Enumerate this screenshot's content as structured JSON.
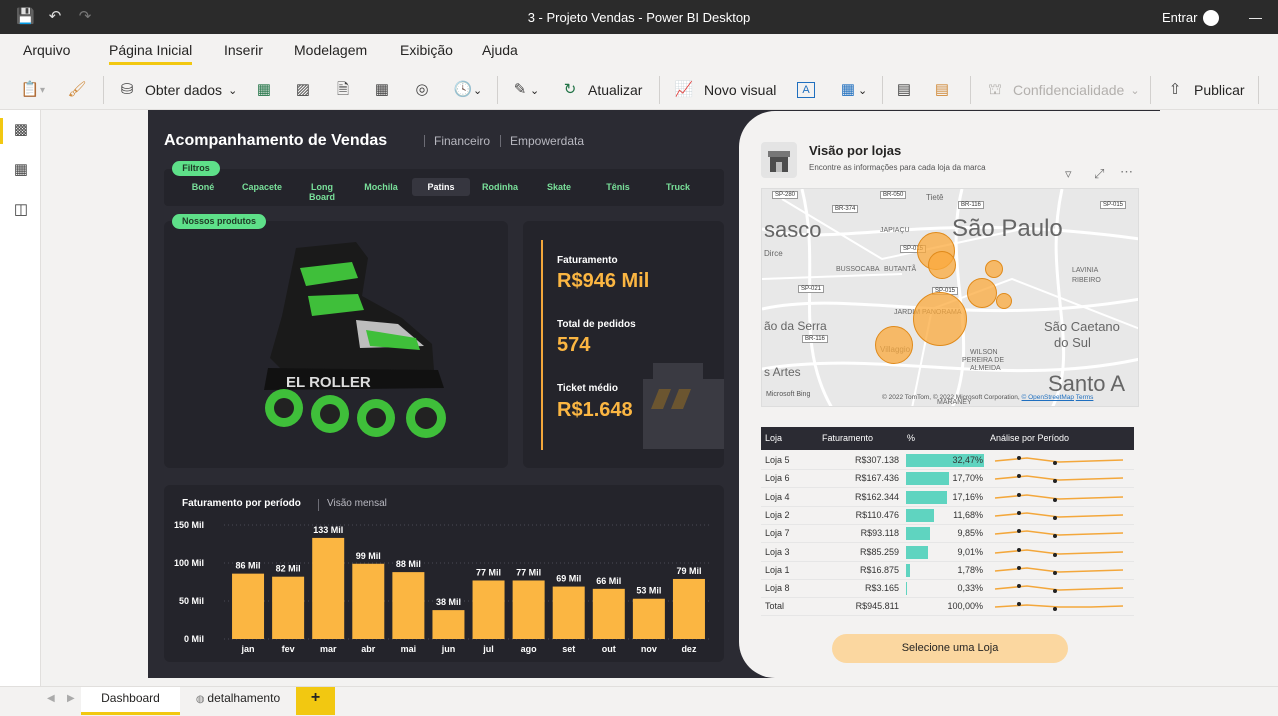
{
  "titlebar": {
    "title": "3 - Projeto Vendas - Power BI Desktop",
    "signin": "Entrar",
    "minimize": "—"
  },
  "menu": [
    "Arquivo",
    "Página Inicial",
    "Inserir",
    "Modelagem",
    "Exibição",
    "Ajuda"
  ],
  "ribbon": {
    "get_data": "Obter dados",
    "refresh": "Atualizar",
    "new_visual": "Novo visual",
    "sensitivity": "Confidencialidade",
    "publish": "Publicar"
  },
  "report": {
    "title": "Acompanhamento de Vendas",
    "subtitle1": "Financeiro",
    "subtitle2": "Empowerdata",
    "filters_label": "Filtros",
    "filters": [
      "Boné",
      "Capacete",
      "Long Board",
      "Mochila",
      "Patins",
      "Rodinha",
      "Skate",
      "Tênis",
      "Truck"
    ],
    "selected_filter": "Patins",
    "products_label": "Nossos produtos",
    "kpis": [
      {
        "label": "Faturamento",
        "value": "R$946 Mil"
      },
      {
        "label": "Total de pedidos",
        "value": "574"
      },
      {
        "label": "Ticket médio",
        "value": "R$1.648"
      }
    ]
  },
  "chart_title": "Faturamento por período",
  "chart_subtitle": "Visão mensal",
  "chart_data": {
    "type": "bar",
    "categories": [
      "jan",
      "fev",
      "mar",
      "abr",
      "mai",
      "jun",
      "jul",
      "ago",
      "set",
      "out",
      "nov",
      "dez"
    ],
    "values": [
      86,
      82,
      133,
      99,
      88,
      38,
      77,
      77,
      69,
      66,
      53,
      79
    ],
    "data_labels": [
      "86 Mil",
      "82 Mil",
      "133 Mil",
      "99 Mil",
      "88 Mil",
      "38 Mil",
      "77 Mil",
      "77 Mil",
      "69 Mil",
      "66 Mil",
      "53 Mil",
      "79 Mil"
    ],
    "y_ticks": [
      "150 Mil",
      "100 Mil",
      "50 Mil",
      "0 Mil"
    ],
    "ylim": [
      0,
      150
    ],
    "bar_color": "#fbb642"
  },
  "right": {
    "title": "Visão por lojas",
    "subtitle": "Encontre as informações para cada loja da marca",
    "map": {
      "labels": [
        "sasco",
        "São Paulo",
        "Dirce",
        "JAPIAÇU",
        "BUSSOCABA",
        "BUTANTÃ",
        "JARDIM PANORAMA",
        "ão da Serra",
        "WILSON",
        "PEREIRA DE",
        "ALMEIDA",
        "Villaggio",
        "s Artes",
        "São Caetano",
        "do Sul",
        "Santo A",
        "LAVINIA",
        "RIBEIRO",
        "Tietê",
        "MARANEY"
      ],
      "roads": [
        "SP-280",
        "BR-050",
        "BR-374",
        "BR-116",
        "SP-015",
        "SP-021",
        "SP-015",
        "SP-015",
        "BR-116"
      ],
      "bing": "Microsoft Bing",
      "copyright": "© 2022 TomTom, © 2022 Microsoft Corporation, ",
      "osm": "© OpenStreetMap",
      "terms": "Terms"
    },
    "table": {
      "headers": [
        "Loja",
        "Faturamento",
        "%",
        "Análise por Período"
      ],
      "rows": [
        {
          "loja": "Loja 5",
          "fat": "R$307.138",
          "pct": "32,47%",
          "p": 32.47
        },
        {
          "loja": "Loja 6",
          "fat": "R$167.436",
          "pct": "17,70%",
          "p": 17.7
        },
        {
          "loja": "Loja 4",
          "fat": "R$162.344",
          "pct": "17,16%",
          "p": 17.16
        },
        {
          "loja": "Loja 2",
          "fat": "R$110.476",
          "pct": "11,68%",
          "p": 11.68
        },
        {
          "loja": "Loja 7",
          "fat": "R$93.118",
          "pct": "9,85%",
          "p": 9.85
        },
        {
          "loja": "Loja 3",
          "fat": "R$85.259",
          "pct": "9,01%",
          "p": 9.01
        },
        {
          "loja": "Loja 1",
          "fat": "R$16.875",
          "pct": "1,78%",
          "p": 1.78
        },
        {
          "loja": "Loja 8",
          "fat": "R$3.165",
          "pct": "0,33%",
          "p": 0.33
        }
      ],
      "total": {
        "loja": "Total",
        "fat": "R$945.811",
        "pct": "100,00%"
      }
    },
    "button": "Selecione uma Loja"
  },
  "tabs": {
    "dashboard": "Dashboard",
    "detalhamento": "detalhamento",
    "add": "+"
  }
}
